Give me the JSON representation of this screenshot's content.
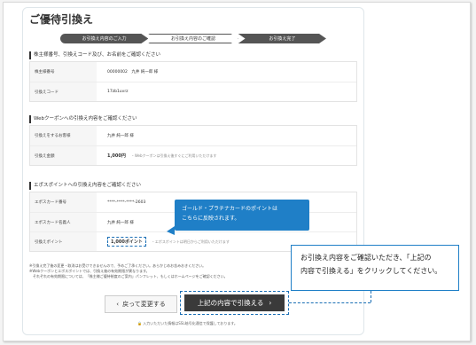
{
  "page": {
    "title": "ご優待引換え"
  },
  "steps": [
    "お引換え内容のご入力",
    "お引換え内容のご確認",
    "お引換え完了"
  ],
  "sections": {
    "s1": {
      "heading": "株主様番号、引換えコード及び、お名前をご確認ください",
      "rows": [
        {
          "label": "株主様番号",
          "value": "00000002　九井 純一郎 様"
        },
        {
          "label": "引換えコード",
          "value": "17zb1uvrz"
        }
      ]
    },
    "s2": {
      "heading": "Webクーポンへの引換え内容をご確認ください",
      "rows": [
        {
          "label": "引換えをするお客様",
          "value": "九井 純一郎 様"
        },
        {
          "label": "引換え金額",
          "value": "1,000円",
          "note": "・Webクーポンは引換え後すぐにご利用いただけます"
        }
      ]
    },
    "s3": {
      "heading": "エポスポイントへの引換え内容をご確認ください",
      "rows": [
        {
          "label": "エポスカード番号",
          "value": "****-****-****-2603"
        },
        {
          "label": "エポスカード名義人",
          "value": "九井 純一郎 様"
        },
        {
          "label": "引換えポイント",
          "value": "1,000ポイント",
          "note": "・エポスポイントは明日からご利用いただけます"
        }
      ]
    }
  },
  "callout": {
    "line1": "ゴールド・プラチナカードのポイントは",
    "line2": "こちらに反映されます。"
  },
  "bubble": {
    "line1": "お引換え内容をご確認いただき、「上記の",
    "line2": "内容で引換える」をクリックしてください。"
  },
  "notes": [
    "※引換え完了後の変更・取消はお受けできませんので、予めご了承ください。あらかじめお含みおきください。",
    "※Webクーポンとエポスポイントでは、引換え後の有効期限が異なります。",
    "　それぞれの有効期限については、「株主様ご優待制度のご案内」パンフレット、もしくはホームページをご確認ください。"
  ],
  "buttons": {
    "back": "戻って変更する",
    "confirm": "上記の内容で引換える"
  },
  "footer": "入力いただいた情報はSSL暗号化通信で保護しております。"
}
